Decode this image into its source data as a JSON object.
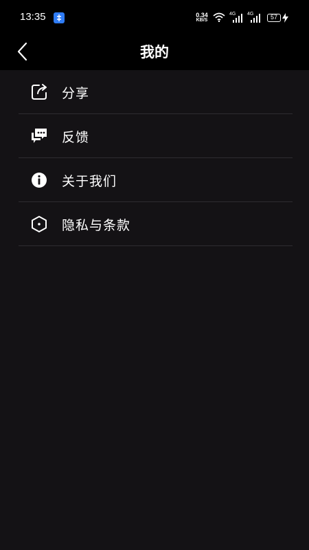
{
  "status_bar": {
    "time": "13:35",
    "net_speed_value": "0.34",
    "net_speed_unit": "KB/S",
    "signal_1_label": "4G",
    "signal_2_label": "4G",
    "battery_level": "57"
  },
  "header": {
    "title": "我的"
  },
  "menu": {
    "items": [
      {
        "label": "分享",
        "icon": "share-icon"
      },
      {
        "label": "反馈",
        "icon": "feedback-icon"
      },
      {
        "label": "关于我们",
        "icon": "info-icon"
      },
      {
        "label": "隐私与条款",
        "icon": "privacy-icon"
      }
    ]
  },
  "colors": {
    "background": "#141215",
    "header_background": "#000000",
    "divider": "#2e2c30",
    "text": "#ffffff"
  }
}
